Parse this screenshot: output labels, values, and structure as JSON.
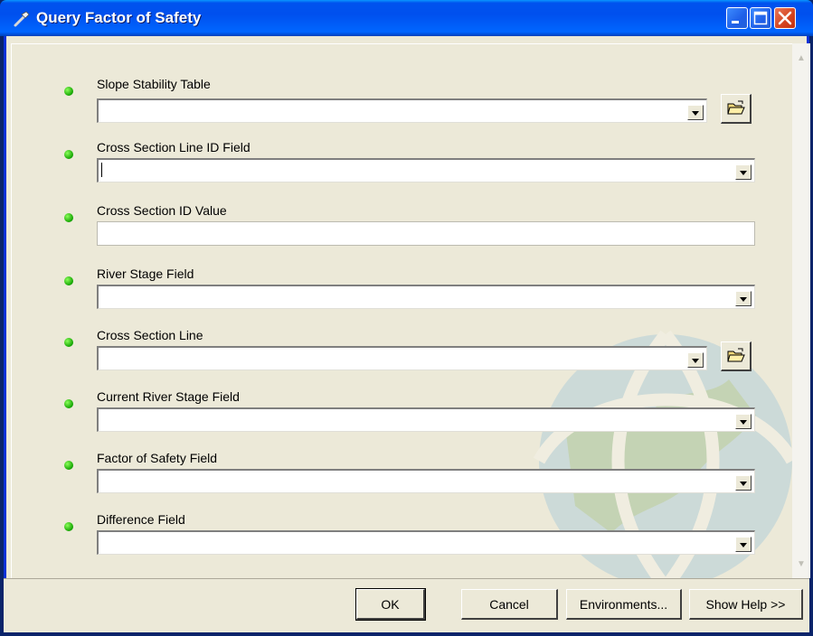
{
  "window": {
    "title": "Query Factor of Safety",
    "icon": "hammer-icon"
  },
  "titlebar_buttons": [
    "minimize-icon",
    "maximize-icon",
    "close-icon"
  ],
  "parameters": [
    {
      "label": "Slope Stability Table",
      "type": "dropdown",
      "value": "",
      "browse": true
    },
    {
      "label": "Cross Section Line ID Field",
      "type": "dropdown",
      "value": "",
      "browse": false,
      "focused": true
    },
    {
      "label": "Cross Section ID Value",
      "type": "text",
      "value": "",
      "browse": false
    },
    {
      "label": "River Stage Field",
      "type": "dropdown",
      "value": "",
      "browse": false
    },
    {
      "label": "Cross Section Line",
      "type": "dropdown",
      "value": "",
      "browse": true
    },
    {
      "label": "Current River Stage Field",
      "type": "dropdown",
      "value": "",
      "browse": false
    },
    {
      "label": "Factor of Safety Field",
      "type": "dropdown",
      "value": "",
      "browse": false
    },
    {
      "label": "Difference Field",
      "type": "dropdown",
      "value": "",
      "browse": false
    }
  ],
  "buttons": {
    "ok": "OK",
    "cancel": "Cancel",
    "environments": "Environments...",
    "show_help": "Show Help >>"
  },
  "colors": {
    "required_dot": "#12A300",
    "titlebar": "#0050EE",
    "dialog_bg": "#ECE9D8"
  }
}
